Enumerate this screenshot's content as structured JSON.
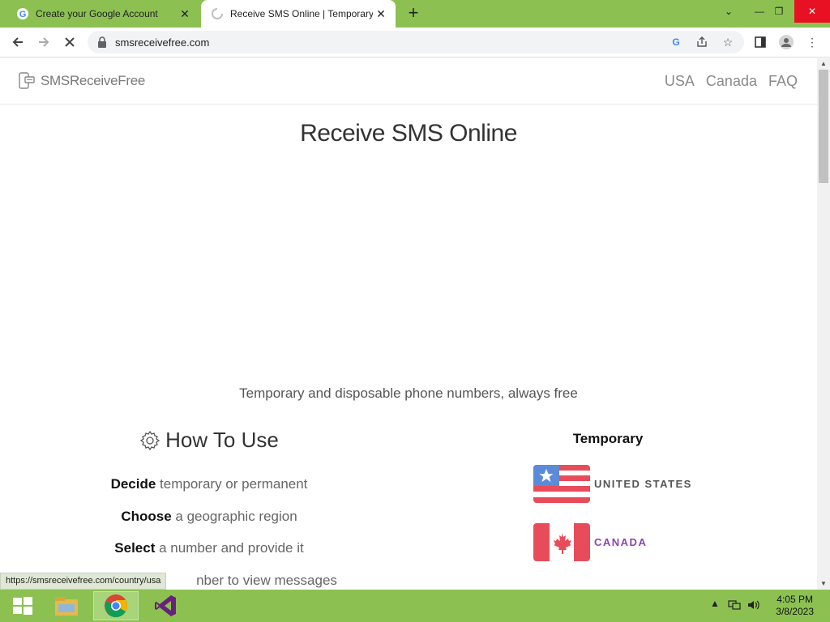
{
  "browser": {
    "tabs": [
      {
        "title": "Create your Google Account",
        "active": false
      },
      {
        "title": "Receive SMS Online | Temporary",
        "active": true
      }
    ],
    "url": "smsreceivefree.com",
    "status_url": "https://smsreceivefree.com/country/usa"
  },
  "site": {
    "logo_text": "SMSReceiveFree",
    "nav": [
      "USA",
      "Canada",
      "FAQ"
    ],
    "title": "Receive SMS Online",
    "tagline": "Temporary and disposable phone numbers, always free",
    "howto": {
      "title": "How To Use",
      "steps": [
        {
          "bold": "Decide",
          "rest": "temporary or permanent"
        },
        {
          "bold": "Choose",
          "rest": "a geographic region"
        },
        {
          "bold": "Select",
          "rest": "a number and provide it"
        },
        {
          "bold": "",
          "rest": "nber to view messages"
        }
      ]
    },
    "numbers": {
      "title": "Temporary",
      "countries": [
        {
          "name": "UNITED STATES",
          "color": "#555555"
        },
        {
          "name": "CANADA",
          "color": "#8e44ad"
        }
      ]
    }
  },
  "taskbar": {
    "time": "4:05 PM",
    "date": "3/8/2023"
  },
  "colors": {
    "titlebar": "#8cc152",
    "taskbar": "#8cc152",
    "flag_red": "#e84c5a",
    "flag_blue": "#5b8ad8"
  }
}
